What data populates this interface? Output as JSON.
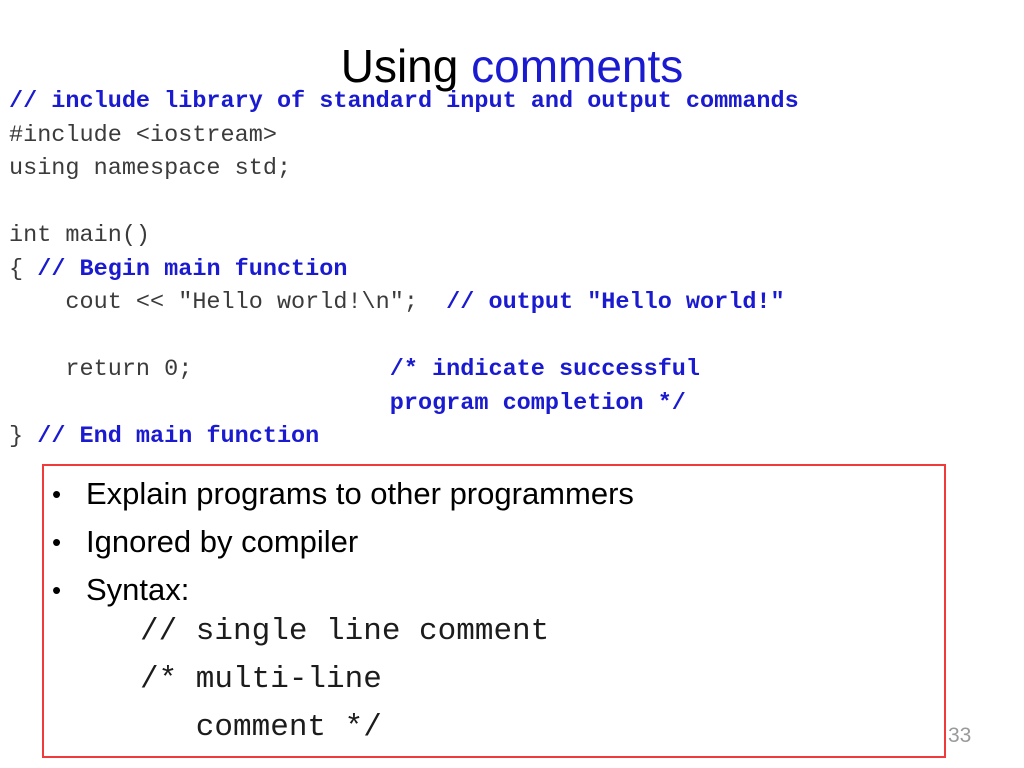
{
  "slide": {
    "title_plain": "Using ",
    "title_accent": "comments",
    "page_number": "33",
    "accent_color": "#1a1ad0",
    "box_color": "#ef3b3b",
    "code_color": "#3b3b3b"
  },
  "code_block": {
    "lines": [
      {
        "segments": [
          {
            "kind": "comment",
            "text": "// include library of standard input and output commands"
          }
        ]
      },
      {
        "segments": [
          {
            "kind": "source",
            "text": "#include <iostream>"
          }
        ]
      },
      {
        "segments": [
          {
            "kind": "source",
            "text": "using namespace std;"
          }
        ]
      },
      {
        "segments": [
          {
            "kind": "source",
            "text": ""
          }
        ]
      },
      {
        "segments": [
          {
            "kind": "source",
            "text": "int main()"
          }
        ]
      },
      {
        "segments": [
          {
            "kind": "source",
            "text": "{ "
          },
          {
            "kind": "comment",
            "text": "// Begin main function"
          }
        ]
      },
      {
        "segments": [
          {
            "kind": "source",
            "text": "    cout << \"Hello world!\\n\";  "
          },
          {
            "kind": "comment",
            "text": "// output \"Hello world!\""
          }
        ]
      },
      {
        "segments": [
          {
            "kind": "source",
            "text": ""
          }
        ]
      },
      {
        "segments": [
          {
            "kind": "source",
            "text": "    return 0;              "
          },
          {
            "kind": "comment",
            "text": "/* indicate successful"
          }
        ]
      },
      {
        "segments": [
          {
            "kind": "source",
            "text": "                           "
          },
          {
            "kind": "comment",
            "text": "program completion */"
          }
        ]
      },
      {
        "segments": [
          {
            "kind": "source",
            "text": "} "
          },
          {
            "kind": "comment",
            "text": "// End main function"
          }
        ]
      }
    ]
  },
  "bullets": {
    "marker": "•",
    "items": [
      "Explain programs to other programmers",
      "Ignored by compiler",
      "Syntax:"
    ]
  },
  "syntax_samples": {
    "lines": [
      "// single line comment",
      "/* multi-line",
      "   comment */"
    ]
  }
}
